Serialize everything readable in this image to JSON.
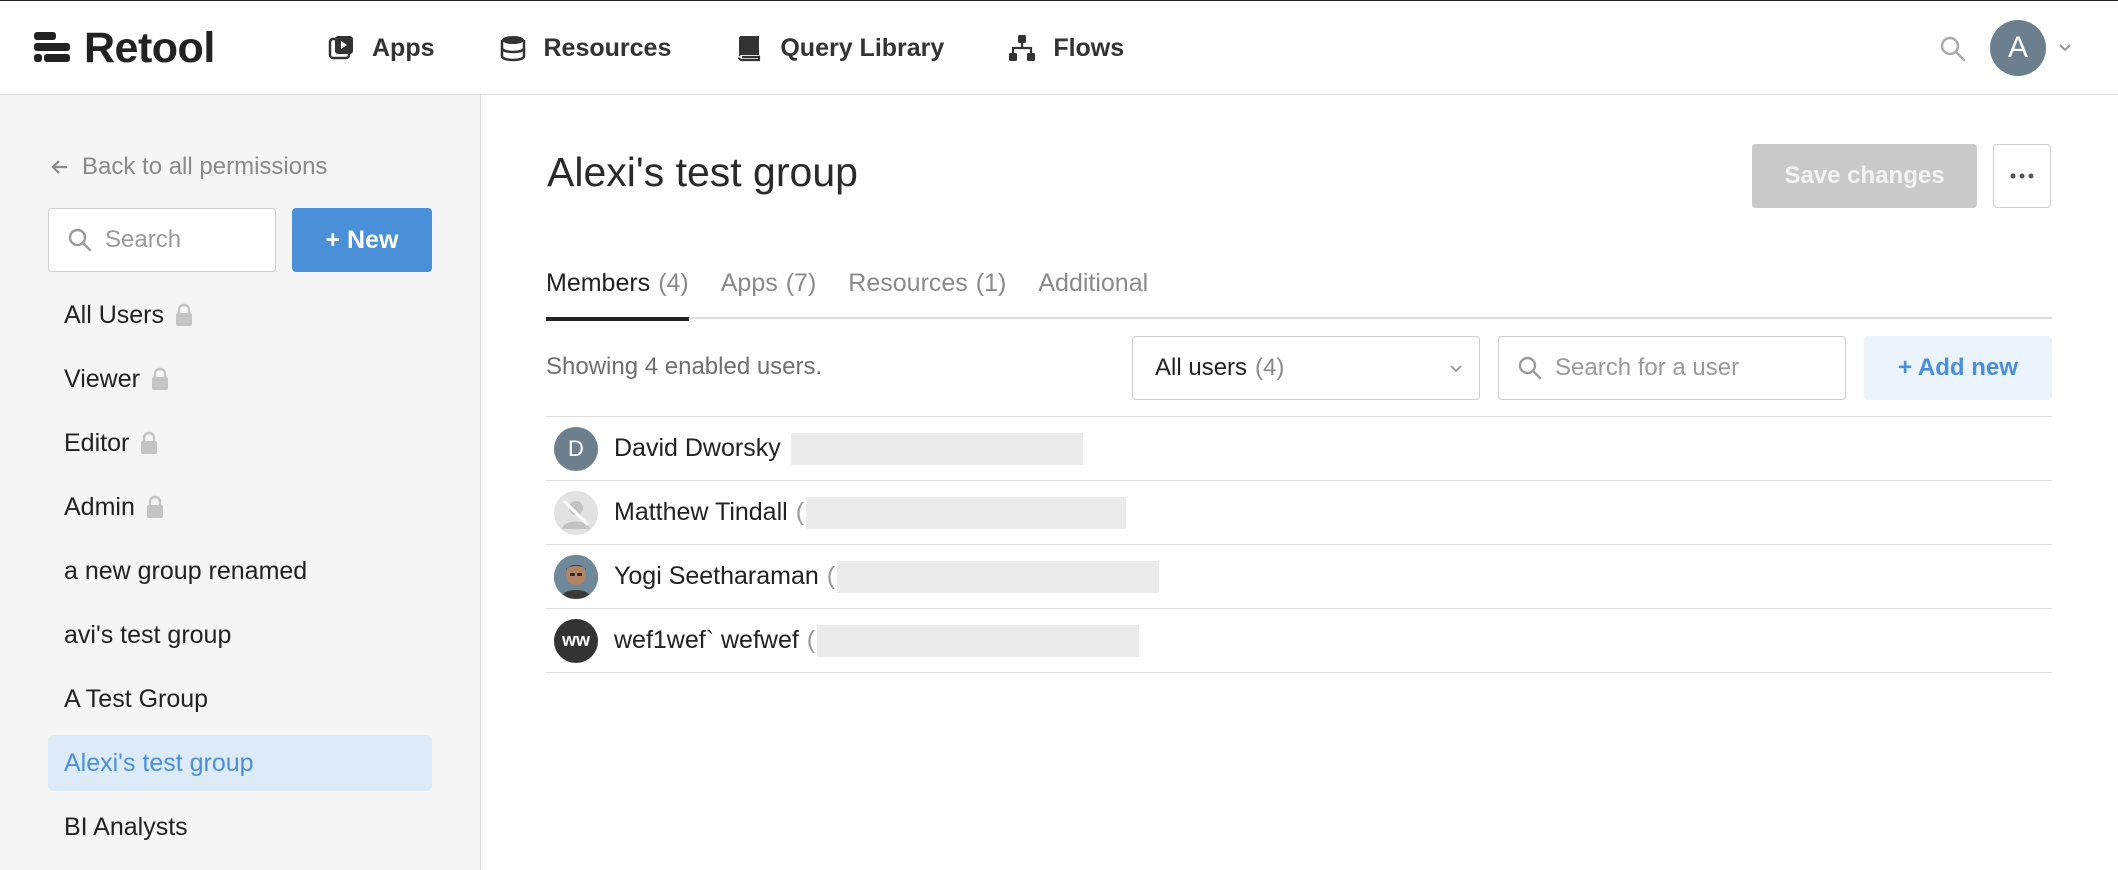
{
  "app": {
    "name": "Retool",
    "nav": [
      {
        "label": "Apps",
        "icon": "apps-icon"
      },
      {
        "label": "Resources",
        "icon": "database-icon"
      },
      {
        "label": "Query Library",
        "icon": "book-icon"
      },
      {
        "label": "Flows",
        "icon": "flows-icon"
      }
    ],
    "user_initial": "A"
  },
  "sidebar": {
    "back_label": "Back to all permissions",
    "search_placeholder": "Search",
    "new_label": "+ New",
    "groups": [
      {
        "label": "All Users",
        "locked": true
      },
      {
        "label": "Viewer",
        "locked": true
      },
      {
        "label": "Editor",
        "locked": true
      },
      {
        "label": "Admin",
        "locked": true
      },
      {
        "label": "a new group renamed",
        "locked": false
      },
      {
        "label": "avi's test group",
        "locked": false
      },
      {
        "label": "A Test Group",
        "locked": false
      },
      {
        "label": "Alexi's test group",
        "locked": false,
        "active": true
      },
      {
        "label": "BI Analysts",
        "locked": false
      }
    ]
  },
  "main": {
    "title": "Alexi's test group",
    "save_label": "Save changes",
    "tabs": [
      {
        "label": "Members",
        "count": "(4)"
      },
      {
        "label": "Apps",
        "count": "(7)"
      },
      {
        "label": "Resources",
        "count": "(1)"
      },
      {
        "label": "Additional",
        "count": ""
      }
    ],
    "showing_text": "Showing 4 enabled users.",
    "filter": {
      "label": "All users",
      "count": "(4)"
    },
    "user_search_placeholder": "Search for a user",
    "add_label": "+ Add new",
    "users": [
      {
        "name": "David Dworsky",
        "initials": "D",
        "avatar_color": "#6b7f8f",
        "email_prefix": ""
      },
      {
        "name": "Matthew Tindall",
        "initials": "",
        "avatar_color": "#d9d9d9",
        "email_prefix": "("
      },
      {
        "name": "Yogi Seetharaman",
        "initials": "",
        "avatar_color": "#5a4a3a",
        "email_prefix": "("
      },
      {
        "name": "wef1wef` wefwef",
        "initials": "ww",
        "avatar_color": "#333333",
        "email_prefix": "("
      }
    ]
  },
  "colors": {
    "accent": "#4a90d9",
    "active_bg": "#ddebf9",
    "sidebar_bg": "#f5f5f5"
  }
}
